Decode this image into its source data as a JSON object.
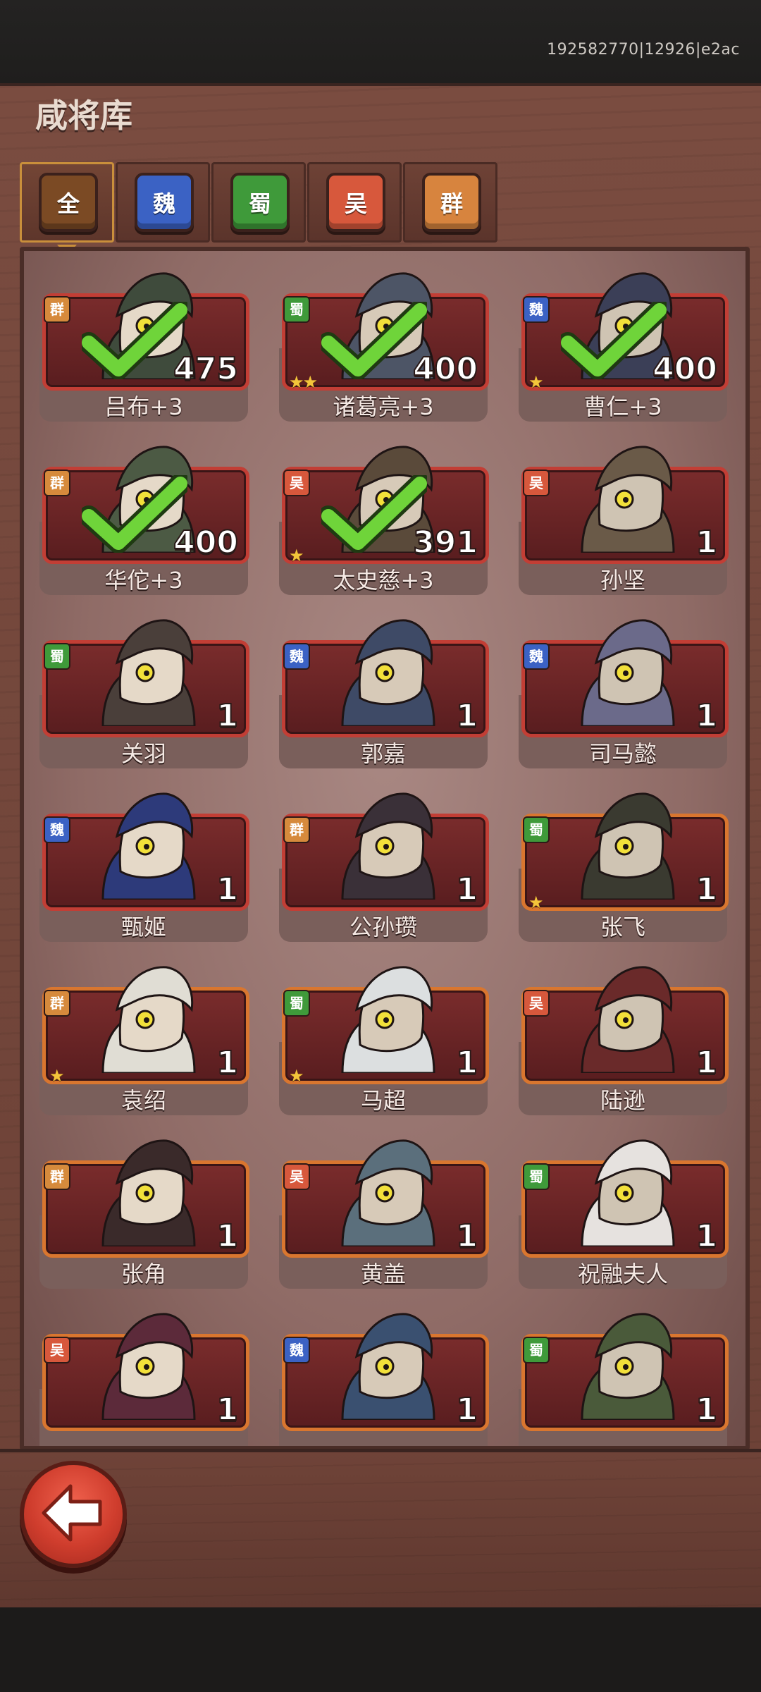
{
  "build_id": "192582770|12926|e2ac",
  "title": "咸将库",
  "tabs": [
    {
      "label": "全",
      "color": "#7b4a24",
      "active": true
    },
    {
      "label": "魏",
      "color": "#3b62c4",
      "active": false
    },
    {
      "label": "蜀",
      "color": "#3f9a3a",
      "active": false
    },
    {
      "label": "吴",
      "color": "#d7583c",
      "active": false
    },
    {
      "label": "群",
      "color": "#d7843e",
      "active": false
    }
  ],
  "faction_colors": {
    "魏": "#3b62c4",
    "蜀": "#3f9a3a",
    "吴": "#d7583c",
    "群": "#d68a3c"
  },
  "heroes": [
    {
      "name": "吕布+3",
      "faction": "群",
      "count": "475",
      "stars": 0,
      "checked": true,
      "rare": false
    },
    {
      "name": "诸葛亮+3",
      "faction": "蜀",
      "count": "400",
      "stars": 2,
      "checked": true,
      "rare": false
    },
    {
      "name": "曹仁+3",
      "faction": "魏",
      "count": "400",
      "stars": 1,
      "checked": true,
      "rare": false
    },
    {
      "name": "华佗+3",
      "faction": "群",
      "count": "400",
      "stars": 0,
      "checked": true,
      "rare": false
    },
    {
      "name": "太史慈+3",
      "faction": "吴",
      "count": "391",
      "stars": 1,
      "checked": true,
      "rare": false
    },
    {
      "name": "孙坚",
      "faction": "吴",
      "count": "1",
      "stars": 0,
      "checked": false,
      "rare": false
    },
    {
      "name": "关羽",
      "faction": "蜀",
      "count": "1",
      "stars": 0,
      "checked": false,
      "rare": false
    },
    {
      "name": "郭嘉",
      "faction": "魏",
      "count": "1",
      "stars": 0,
      "checked": false,
      "rare": false
    },
    {
      "name": "司马懿",
      "faction": "魏",
      "count": "1",
      "stars": 0,
      "checked": false,
      "rare": false
    },
    {
      "name": "甄姬",
      "faction": "魏",
      "count": "1",
      "stars": 0,
      "checked": false,
      "rare": false
    },
    {
      "name": "公孙瓒",
      "faction": "群",
      "count": "1",
      "stars": 0,
      "checked": false,
      "rare": false
    },
    {
      "name": "张飞",
      "faction": "蜀",
      "count": "1",
      "stars": 1,
      "checked": false,
      "rare": true
    },
    {
      "name": "袁绍",
      "faction": "群",
      "count": "1",
      "stars": 1,
      "checked": false,
      "rare": true
    },
    {
      "name": "马超",
      "faction": "蜀",
      "count": "1",
      "stars": 1,
      "checked": false,
      "rare": true
    },
    {
      "name": "陆逊",
      "faction": "吴",
      "count": "1",
      "stars": 0,
      "checked": false,
      "rare": true
    },
    {
      "name": "张角",
      "faction": "群",
      "count": "1",
      "stars": 0,
      "checked": false,
      "rare": true
    },
    {
      "name": "黄盖",
      "faction": "吴",
      "count": "1",
      "stars": 0,
      "checked": false,
      "rare": true
    },
    {
      "name": "祝融夫人",
      "faction": "蜀",
      "count": "1",
      "stars": 0,
      "checked": false,
      "rare": true
    },
    {
      "name": "",
      "faction": "吴",
      "count": "1",
      "stars": 0,
      "checked": false,
      "rare": true
    },
    {
      "name": "",
      "faction": "魏",
      "count": "1",
      "stars": 0,
      "checked": false,
      "rare": true
    },
    {
      "name": "",
      "faction": "蜀",
      "count": "1",
      "stars": 0,
      "checked": false,
      "rare": true
    }
  ],
  "back_button": {
    "icon": "back-arrow-icon"
  }
}
